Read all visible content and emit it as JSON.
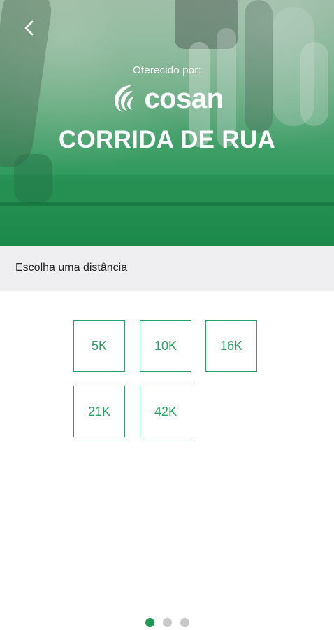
{
  "header": {
    "back_icon": "chevron-left-icon",
    "sponsor_label": "Oferecido por:",
    "brand_name": "cosan",
    "event_title": "CORRIDA DE RUA"
  },
  "section": {
    "title": "Escolha uma distância"
  },
  "distances": [
    "5K",
    "10K",
    "16K",
    "21K",
    "42K"
  ],
  "pager": {
    "total": 3,
    "current": 1
  },
  "colors": {
    "accent": "#2aa160",
    "hero_green": "#1f9150",
    "section_bg": "#efeff2",
    "dot_inactive": "#c8c8c8"
  }
}
